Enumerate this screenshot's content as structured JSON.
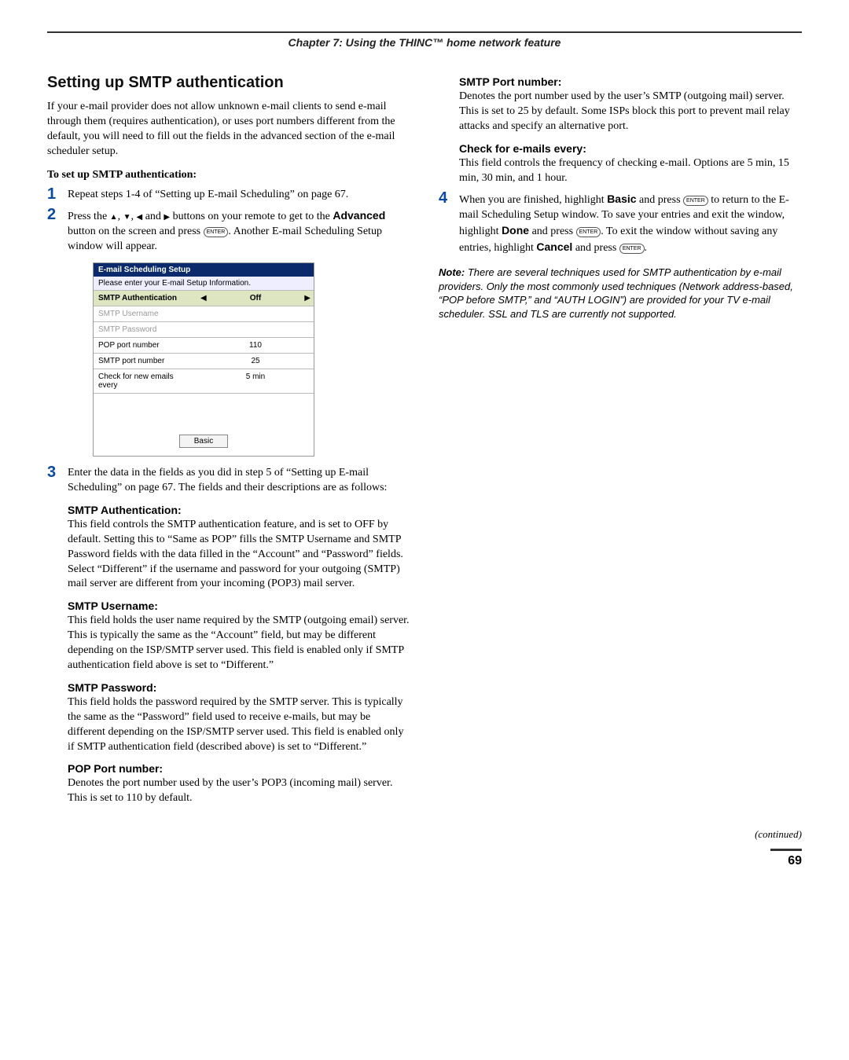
{
  "chapter": "Chapter 7: Using the THINC™ home network feature",
  "section_title": "Setting up SMTP authentication",
  "intro": "If your e-mail provider does not allow unknown e-mail clients to send e-mail through them (requires authentication), or uses port numbers different from the default, you will need to fill out the fields in the advanced section of the e-mail scheduler setup.",
  "to_set_up": "To set up SMTP authentication:",
  "steps": {
    "s1": "Repeat steps 1-4 of “Setting up E-mail Scheduling” on page 67.",
    "s2a": "Press the ",
    "s2b": " buttons on your remote to get to the ",
    "s2_adv": "Advanced",
    "s2c": " button on the screen and press ",
    "s2d": ". Another E-mail Scheduling Setup window will appear.",
    "s3": "Enter the data in the fields as you did in step 5 of “Setting up E-mail Scheduling” on page 67. The fields and their descriptions are as follows:",
    "s4a": "When you are finished, highlight ",
    "s4_basic": "Basic",
    "s4b": " and press ",
    "s4c": " to return to the E-mail Scheduling Setup window. To save your entries and exit the window, highlight ",
    "s4_done": "Done",
    "s4d": " and press ",
    "s4e": ". To exit the window without saving any entries, highlight ",
    "s4_cancel": "Cancel",
    "s4f": " and press ",
    "s4g": "."
  },
  "sub": {
    "auth_h": "SMTP Authentication:",
    "auth_t": "This field controls the SMTP authentication feature, and is set to OFF by default. Setting this to “Same as POP” fills the SMTP Username and SMTP Password fields with the data filled in the “Account” and “Password” fields. Select “Different” if the username and password for your outgoing (SMTP) mail server are different from your incoming (POP3) mail server.",
    "user_h": "SMTP Username:",
    "user_t": "This field holds the user name required by the SMTP (outgoing email) server. This is typically the same as the “Account” field, but may be different depending on the ISP/SMTP server used. This field is enabled only if SMTP authentication field above is set to “Different.”",
    "pass_h": "SMTP Password:",
    "pass_t": "This field holds the password required by the SMTP server. This is typically the same as the “Password” field used to receive e-mails, but may be different depending on the ISP/SMTP server used. This field is enabled only if SMTP authentication field (described above) is set to “Different.”",
    "pop_h": "POP Port number:",
    "pop_t": "Denotes the port number used by the user’s POP3 (incoming mail) server. This is set to 110 by default.",
    "smtp_h": "SMTP Port number:",
    "smtp_t": "Denotes the port number used by the user’s SMTP (outgoing mail) server. This is set to 25 by default. Some ISPs block this port to prevent mail relay attacks and specify an alternative port.",
    "check_h": "Check for e-mails every:",
    "check_t": "This field controls the frequency of checking e-mail. Options are 5 min, 15 min, 30 min, and 1 hour."
  },
  "note_label": "Note:",
  "note_text": " There are several techniques used for SMTP authentication by e-mail providers. Only the most commonly used techniques (Network address-based, “POP before SMTP,” and “AUTH LOGIN”) are provided for your TV e-mail scheduler. SSL and TLS are currently not supported.",
  "mini": {
    "title": "E-mail Scheduling Setup",
    "subtitle": "Please enter your E-mail Setup Information.",
    "rows": {
      "r0l": "SMTP Authentication",
      "r0v": "Off",
      "r1l": "SMTP Username",
      "r1v": "",
      "r2l": "SMTP Password",
      "r2v": "",
      "r3l": "POP port number",
      "r3v": "110",
      "r4l": "SMTP port number",
      "r4v": "25",
      "r5l": "Check for new emails every",
      "r5v": "5 min"
    },
    "button": "Basic"
  },
  "enter_text": "ENTER",
  "arrow_sep1": ", ",
  "arrow_sep2": " and ",
  "continued": "(continued)",
  "pagenum": "69"
}
